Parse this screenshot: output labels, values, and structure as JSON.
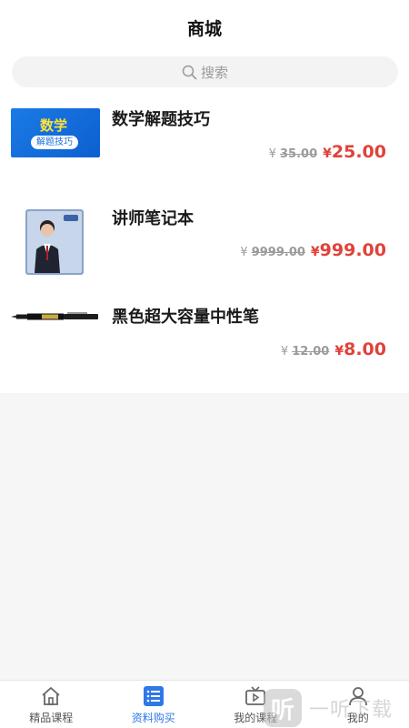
{
  "header": {
    "title": "商城"
  },
  "search": {
    "placeholder": "搜索"
  },
  "products": [
    {
      "name": "数学解题技巧",
      "thumb_title": "数学",
      "thumb_subtitle": "解题技巧",
      "currency": "¥",
      "original_price": "35.00",
      "price": "25.00"
    },
    {
      "name": "讲师笔记本",
      "currency": "¥",
      "original_price": "9999.00",
      "price": "999.00"
    },
    {
      "name": "黑色超大容量中性笔",
      "currency": "¥",
      "original_price": "12.00",
      "price": "8.00"
    }
  ],
  "tabbar": {
    "tabs": [
      {
        "label": "精品课程",
        "icon": "home-icon",
        "active": false
      },
      {
        "label": "资料购买",
        "icon": "list-icon",
        "active": true
      },
      {
        "label": "我的课程",
        "icon": "tv-icon",
        "active": false
      },
      {
        "label": "我的",
        "icon": "user-icon",
        "active": false
      }
    ]
  },
  "watermark": {
    "text": "一听下载",
    "logo_char": "听"
  },
  "colors": {
    "accent": "#2f78e6",
    "price": "#e0423a"
  }
}
